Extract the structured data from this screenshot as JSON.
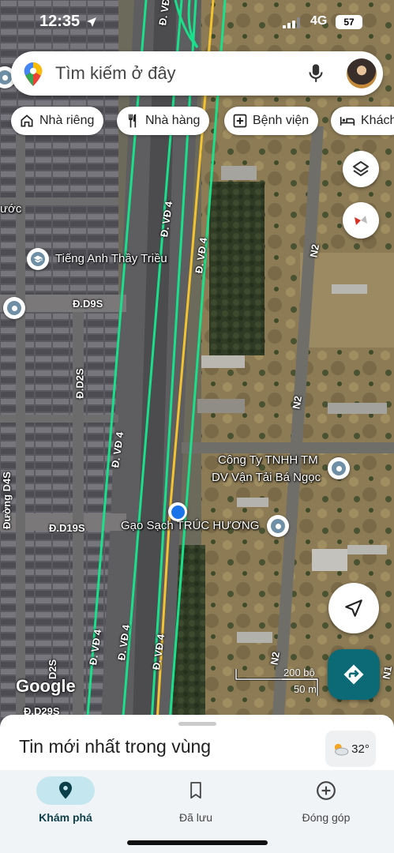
{
  "status_bar": {
    "time": "12:35",
    "network": "4G",
    "battery": "57"
  },
  "search": {
    "placeholder": "Tìm kiếm ở đây",
    "logo_icon": "google-maps-pin-icon",
    "mic_icon": "mic-icon"
  },
  "chips": [
    {
      "label": "Nhà riêng",
      "icon": "home-icon"
    },
    {
      "label": "Nhà hàng",
      "icon": "fork-knife-icon"
    },
    {
      "label": "Bệnh viện",
      "icon": "hospital-icon"
    },
    {
      "label": "Khách",
      "icon": "bed-icon"
    }
  ],
  "map": {
    "places": {
      "school": "Tiếng Anh Thầy Triều",
      "company_line1": "Công Ty TNHH TM",
      "company_line2": "DV Vận Tải Bá Ngọc",
      "rice_shop": "Gạo Sạch TRÚC HƯƠNG",
      "partial_left": "ước"
    },
    "roads": {
      "vd4": "Đ. VĐ 4",
      "d9s": "Đ.D9S",
      "d2s": "Đ.D2S",
      "d19s": "Đ.D19S",
      "d4s": "Đường D4S",
      "d2s_lower": "D2S",
      "n2": "N2",
      "n1": "N1",
      "bottom_partial": "Đ.D29S"
    },
    "attribution": "Google",
    "scale": {
      "top": "200 bộ",
      "bottom": "50 m"
    }
  },
  "sheet": {
    "title": "Tin mới nhất trong vùng",
    "temperature": "32°"
  },
  "nav": [
    {
      "label": "Khám phá",
      "icon": "explore-pin-icon",
      "active": true
    },
    {
      "label": "Đã lưu",
      "icon": "bookmark-icon",
      "active": false
    },
    {
      "label": "Đóng góp",
      "icon": "add-circle-icon",
      "active": false
    }
  ],
  "colors": {
    "accent": "#0c6a76",
    "route_green": "#19e08a",
    "road_yellow": "#f4c430",
    "location_blue": "#1a73e8"
  }
}
